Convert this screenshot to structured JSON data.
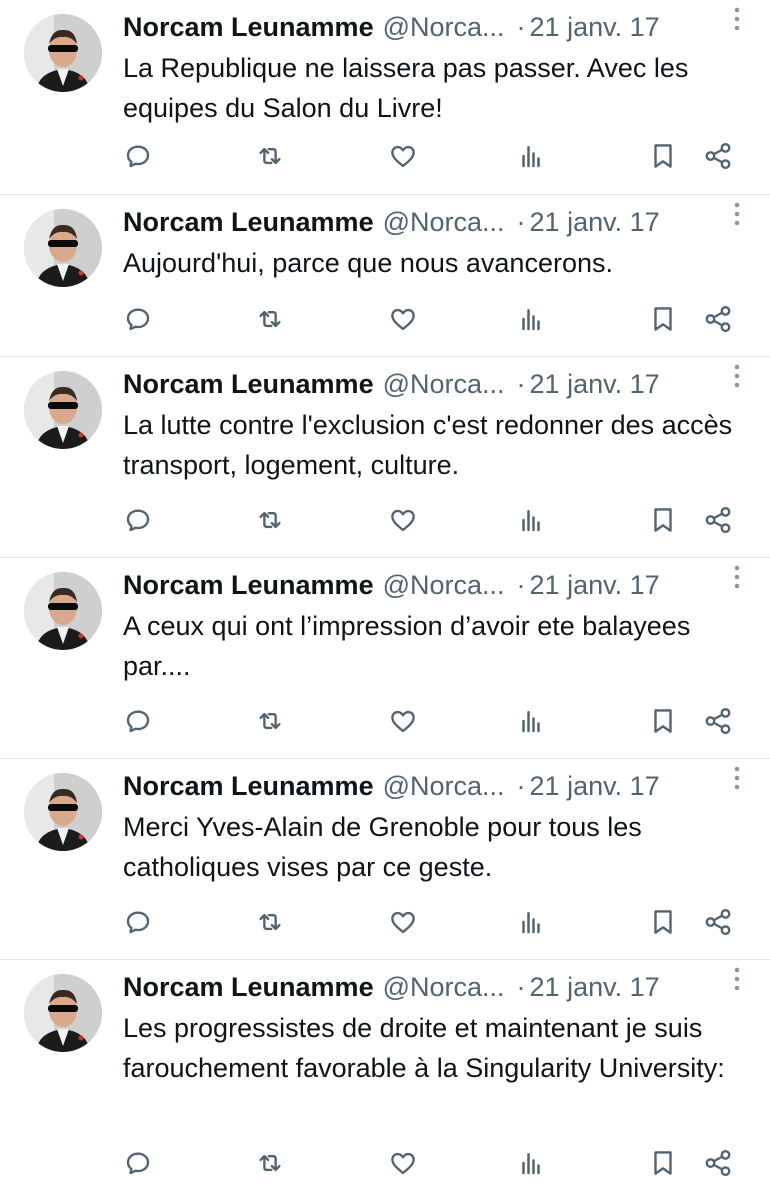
{
  "colors": {
    "text": "#0f1419",
    "secondary": "#536471",
    "divider": "#e3e6e9"
  },
  "tweets": [
    {
      "name": "Norcam Leunamme",
      "handle": "@Norca...",
      "separator": "·",
      "date": "21 janv. 17",
      "text": "La Republique ne laissera pas passer. Avec les equipes du Salon du Livre!"
    },
    {
      "name": "Norcam Leunamme",
      "handle": "@Norca...",
      "separator": "·",
      "date": "21 janv. 17",
      "text": "Aujourd'hui, parce que nous avancerons."
    },
    {
      "name": "Norcam Leunamme",
      "handle": "@Norca...",
      "separator": "·",
      "date": "21 janv. 17",
      "text": "La lutte contre l'exclusion c'est redonner des accès transport, logement, culture."
    },
    {
      "name": "Norcam Leunamme",
      "handle": "@Norca...",
      "separator": "·",
      "date": "21 janv. 17",
      "text": "A ceux qui ont l’impression d’avoir ete balayees par...."
    },
    {
      "name": "Norcam Leunamme",
      "handle": "@Norca...",
      "separator": "·",
      "date": "21 janv. 17",
      "text": "Merci Yves-Alain de Grenoble pour tous les catholiques vises par ce geste."
    },
    {
      "name": "Norcam Leunamme",
      "handle": "@Norca...",
      "separator": "·",
      "date": "21 janv. 17",
      "text": "Les progressistes de droite et maintenant je suis farouchement favorable à la Singularity University:"
    }
  ],
  "action_icons": [
    "reply-icon",
    "retweet-icon",
    "like-icon",
    "views-icon",
    "bookmark-icon",
    "share-icon"
  ]
}
